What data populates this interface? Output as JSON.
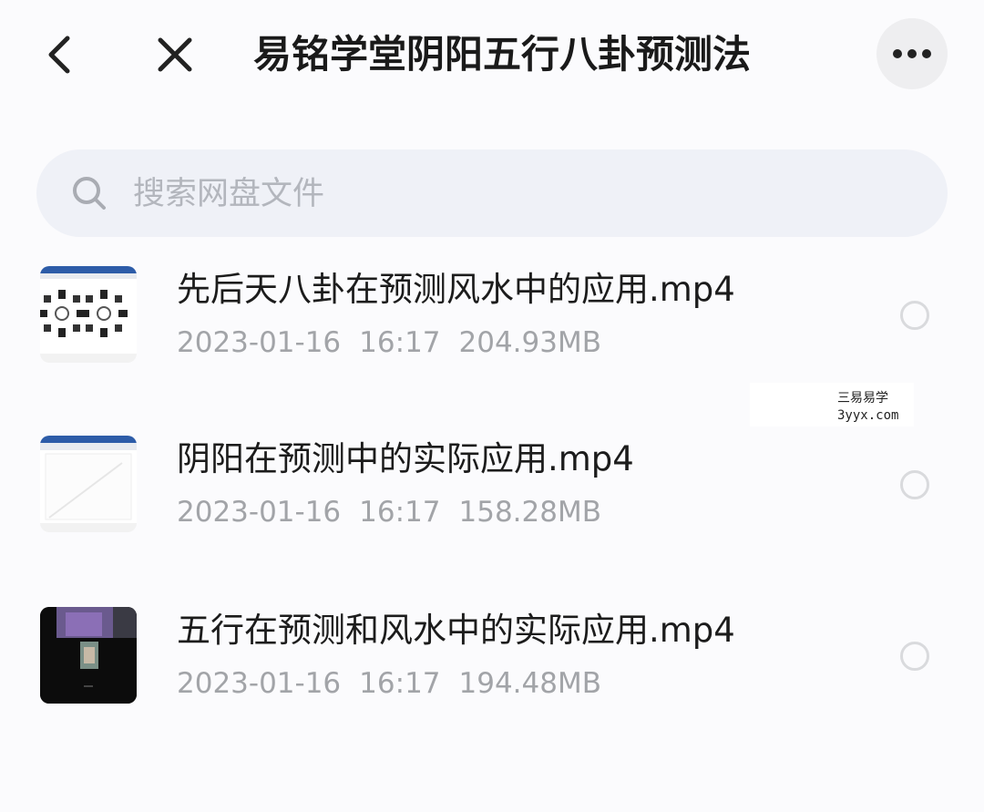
{
  "header": {
    "title": "易铭学堂阴阳五行八卦预测法",
    "back_icon": "chevron-left-icon",
    "close_icon": "close-icon",
    "more_icon": "more-horizontal-icon"
  },
  "search": {
    "placeholder": "搜索网盘文件",
    "icon": "search-icon"
  },
  "files": [
    {
      "name": "先后天八卦在预测风水中的应用.mp4",
      "date": "2023-01-16",
      "time": "16:17",
      "size": "204.93MB",
      "thumbnail": "document-screenshot-bagua"
    },
    {
      "name": "阴阳在预测中的实际应用.mp4",
      "date": "2023-01-16",
      "time": "16:17",
      "size": "158.28MB",
      "thumbnail": "document-screenshot-blank"
    },
    {
      "name": "五行在预测和风水中的实际应用.mp4",
      "date": "2023-01-16",
      "time": "16:17",
      "size": "194.48MB",
      "thumbnail": "video-dark-frame"
    }
  ],
  "watermark": {
    "line1": "三易易学",
    "line2": "3yyx.com"
  },
  "colors": {
    "background": "#fbfbfd",
    "search_bg": "#eff1f7",
    "text_primary": "#1c1c1c",
    "text_secondary": "#a2a4a8"
  }
}
